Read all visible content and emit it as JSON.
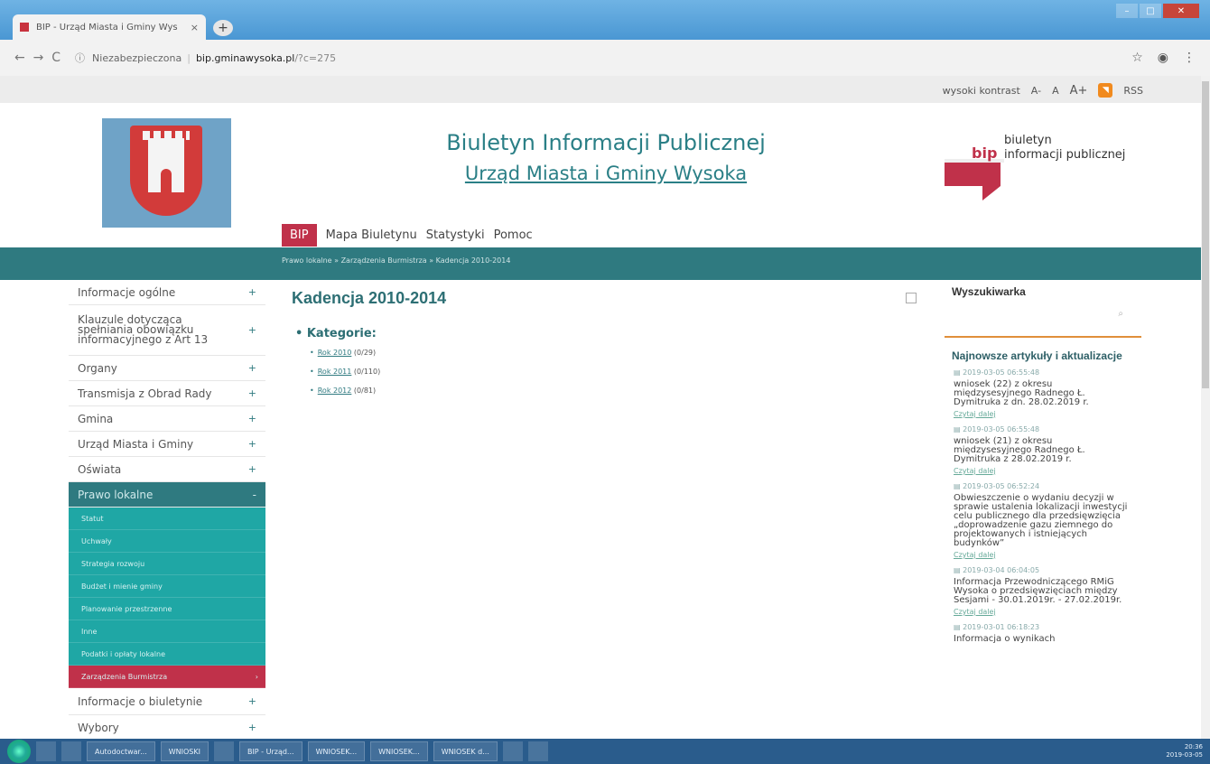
{
  "browser": {
    "tab_title": "BIP - Urząd Miasta i Gminy Wys",
    "tab_close": "×",
    "new_tab": "+",
    "security": "Niezabezpieczona",
    "url_host": "bip.gminawysoka.pl",
    "url_path": "/?c=275"
  },
  "tools": {
    "contrast": "wysoki kontrast",
    "font_small": "A-",
    "font_normal": "A",
    "font_large": "A+",
    "rss": "RSS"
  },
  "header": {
    "title": "Biuletyn Informacji Publicznej",
    "subtitle": "Urząd Miasta i Gminy Wysoka",
    "bip_word": "bip",
    "bip_line1": "biuletyn",
    "bip_line2": "informacji publicznej"
  },
  "nav": {
    "items": [
      "BIP",
      "Mapa Biuletynu",
      "Statystyki",
      "Pomoc"
    ]
  },
  "breadcrumb": "Prawo lokalne » Zarządzenia Burmistrza » Kadencja 2010-2014",
  "sidebar": {
    "items": [
      {
        "label": "Informacje ogólne",
        "sign": "+"
      },
      {
        "label": "Klauzule dotycząca spełniania obowiązku informacyjnego z Art 13",
        "sign": "+"
      },
      {
        "label": "Organy",
        "sign": "+"
      },
      {
        "label": "Transmisja z Obrad Rady",
        "sign": "+"
      },
      {
        "label": "Gmina",
        "sign": "+"
      },
      {
        "label": "Urząd Miasta i Gminy",
        "sign": "+"
      },
      {
        "label": "Oświata",
        "sign": "+"
      },
      {
        "label": "Prawo lokalne",
        "sign": "-"
      }
    ],
    "subitems": [
      "Statut",
      "Uchwały",
      "Strategia rozwoju",
      "Budżet i mienie gminy",
      "Planowanie przestrzenne",
      "Inne",
      "Podatki i opłaty lokalne",
      "Zarządzenia Burmistrza"
    ],
    "after": [
      {
        "label": "Informacje o biuletynie",
        "sign": "+"
      },
      {
        "label": "Wybory",
        "sign": "+"
      }
    ]
  },
  "content": {
    "title": "Kadencja 2010-2014",
    "categories_label": "Kategorie:",
    "categories": [
      {
        "link": "Rok 2010",
        "count": "(0/29)"
      },
      {
        "link": "Rok 2011",
        "count": "(0/110)"
      },
      {
        "link": "Rok 2012",
        "count": "(0/81)"
      }
    ]
  },
  "right": {
    "search_title": "Wyszukiwarka",
    "news_title": "Najnowsze artykuły i aktualizacje",
    "read_more": "Czytaj dalej",
    "news": [
      {
        "date": "2019-03-05 06:55:48",
        "text": "wniosek (22) z okresu międzysesyjnego Radnego Ł. Dymitruka z dn. 28.02.2019 r."
      },
      {
        "date": "2019-03-05 06:55:48",
        "text": "wniosek (21) z okresu międzysesyjnego Radnego Ł. Dymitruka z 28.02.2019 r."
      },
      {
        "date": "2019-03-05 06:52:24",
        "text": "Obwieszczenie o wydaniu decyzji w sprawie ustalenia lokalizacji inwestycji celu publicznego dla przedsięwzięcia „doprowadzenie gazu ziemnego do projektowanych i istniejących budynków”"
      },
      {
        "date": "2019-03-04 06:04:05",
        "text": "Informacja Przewodniczącego RMiG Wysoka o przedsięwzięciach między Sesjami - 30.01.2019r. - 27.02.2019r."
      },
      {
        "date": "2019-03-01 06:18:23",
        "text": "Informacja o wynikach"
      }
    ]
  },
  "taskbar": {
    "items": [
      "Autodoctwar...",
      "WNIOSKI",
      "BIP - Urząd...",
      "WNIOSEK...",
      "WNIOSEK...",
      "WNIOSEK d..."
    ],
    "time": "20:36",
    "date": "2019-03-05"
  }
}
